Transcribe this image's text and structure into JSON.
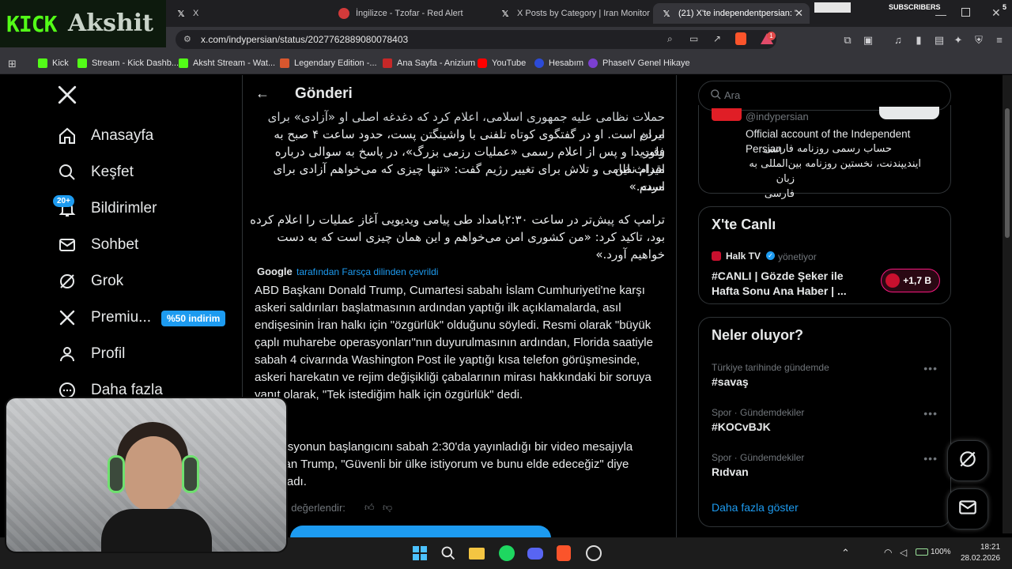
{
  "browser": {
    "tabs": [
      {
        "label": "X",
        "active": false
      },
      {
        "label": "İngilizce - Tzofar - Red Alert",
        "active": false
      },
      {
        "label": "X Posts by Category | Iran Monitor",
        "active": false
      },
      {
        "label": "(21) X'te independentpersian: \"...",
        "active": true
      }
    ],
    "subscribers_label": "SUBSCRIBERS",
    "subscribers_count": "5",
    "url": "x.com/indypersian/status/2027762889080078403",
    "extension_badge": "1",
    "bookmarks": [
      "Kick",
      "Stream - Kick Dashb...",
      "Aksht Stream - Wat...",
      "Legendary Edition -...",
      "Ana Sayfa - Anizium",
      "YouTube",
      "Hesabım",
      "PhaseIV Genel Hikaye"
    ]
  },
  "overlay": {
    "kick_label": "KICK",
    "streamer_name": "Akshit"
  },
  "sidebar": {
    "items": [
      {
        "label": "Anasayfa",
        "icon": "home-icon"
      },
      {
        "label": "Keşfet",
        "icon": "search-icon"
      },
      {
        "label": "Bildirimler",
        "icon": "bell-icon",
        "badge": "20+"
      },
      {
        "label": "Sohbet",
        "icon": "mail-icon"
      },
      {
        "label": "Grok",
        "icon": "grok-icon"
      },
      {
        "label": "Premiu...",
        "icon": "x-logo-icon",
        "badge": "%50 indirim"
      },
      {
        "label": "Profil",
        "icon": "person-icon"
      },
      {
        "label": "Daha fazla",
        "icon": "more-circle-icon"
      }
    ]
  },
  "post": {
    "header_title": "Gönderi",
    "persian_p1_line1": "حملات نظامی علیه جمهوری اسلامی، اعلام کرد که دغدغه اصلی او «آزادی» برای مردم",
    "persian_p1_line2": "ایران است. او در گفتگوی کوتاه تلفنی با واشینگتن پست، حدود ساعت ۴ صبح به وقت",
    "persian_p1_line3": "فلوریدا و پس از اعلام رسمی «عملیات رزمی بزرگ»، در پاسخ به سوالی درباره میراث این",
    "persian_p1_line4": "اقدام نظامی و تلاش برای تغییر رژیم گفت: «تنها چیزی که می‌خواهم آزادی برای مردم",
    "persian_p1_line5": "است.»",
    "persian_p2_line1": "ترامپ که پیش‌تر در ساعت ۲:۳۰بامداد طی پیامی ویدیویی آغاز عملیات را اعلام کرده",
    "persian_p2_line2": "بود، تاکید کرد: «من کشوری امن می‌خواهم و این همان چیزی است که به دست",
    "persian_p2_line3": "خواهیم آورد.»",
    "translated_by_brand": "Google",
    "translated_by_label": "tarafından Farsça dilinden çevrildi",
    "translation_p1": "ABD Başkanı Donald Trump, Cumartesi sabahı İslam Cumhuriyeti'ne karşı askeri saldırıları başlatmasının ardından yaptığı ilk açıklamalarda, asıl endişesinin İran halkı için \"özgürlük\" olduğunu söyledi. Resmi olarak \"büyük çaplı muharebe operasyonları\"nın duyurulmasının ardından, Florida saatiyle sabah 4 civarında Washington Post ile yaptığı kısa telefon görüşmesinde, askeri harekatın ve rejim değişikliği çabalarının mirası hakkındaki bir soruya yanıt olarak, \"Tek istediğim halk için özgürlük\" dedi.",
    "translation_p2": "Operasyonun başlangıcını sabah 2:30'da yayınladığı bir video mesajıyla duyuran Trump, \"Güvenli bir ülke istiyorum ve bunu elde edeceğiz\" diye vurguladı.",
    "rate_label": "Çeviriyi değerlendir:"
  },
  "right": {
    "search_placeholder": "Ara",
    "profile_handle": "@indypersian",
    "profile_bio_en": "Official account of the Independent Persian",
    "profile_bio_fa_line1": "حساب رسمی روزنامه فارسی",
    "profile_bio_fa_line2": "ایندیپندنت، نخستین روزنامه بین‌المللی به",
    "profile_bio_fa_line3": "زبان فارسی",
    "live_title": "X'te Canlı",
    "live_host": "Halk TV",
    "live_host_role": "yönetiyor",
    "live_show_title": "#CANLI | Gözde Şeker ile Hafta Sonu Ana Haber | ...",
    "live_count": "+1,7 B",
    "trends_title": "Neler oluyor?",
    "trends": [
      {
        "meta": "Türkiye tarihinde gündemde",
        "title": "#savaş"
      },
      {
        "meta": "Spor · Gündemdekiler",
        "title": "#KOCvBJK"
      },
      {
        "meta": "Spor · Gündemdekiler",
        "title": "Rıdvan"
      }
    ],
    "show_more": "Daha fazla göster"
  },
  "taskbar": {
    "battery": "100%",
    "time": "18:21",
    "date": "28.02.2026"
  },
  "colors": {
    "accent": "#1d9bf0",
    "kick_green": "#53fc18",
    "live_pink": "#f91880"
  }
}
